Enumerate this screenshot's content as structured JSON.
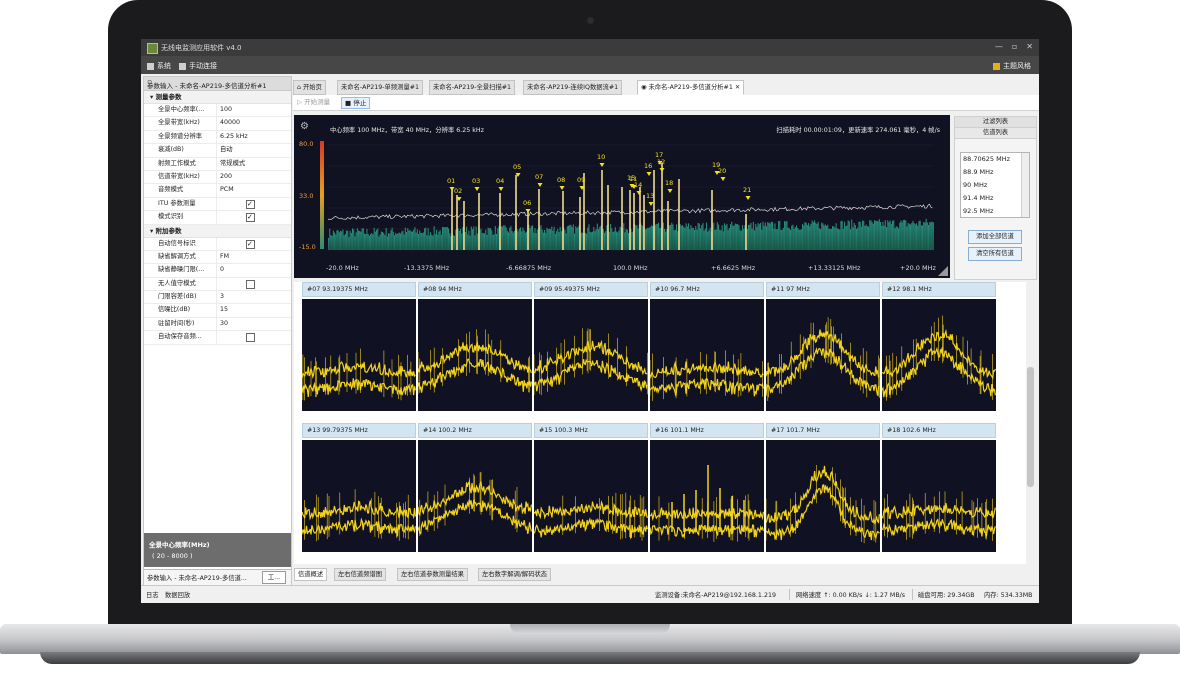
{
  "window": {
    "title": "无线电监测应用软件 v4.0",
    "controls": [
      "—",
      "▫",
      "✕"
    ]
  },
  "menu": {
    "system": "系统",
    "manual_connect": "手动连接",
    "theme": "主题风格"
  },
  "left_panel": {
    "title": "参数输入 - 未命名-AP219-多信道分析#1",
    "groups": [
      {
        "label": "测量参数",
        "rows": [
          {
            "k": "全景中心频率(...",
            "v": "100"
          },
          {
            "k": "全景带宽(kHz)",
            "v": "40000"
          },
          {
            "k": "全景频谱分辨率",
            "v": "6.25 kHz"
          },
          {
            "k": "衰减(dB)",
            "v": "自动"
          },
          {
            "k": "射频工作模式",
            "v": "常规模式"
          },
          {
            "k": "信道带宽(kHz)",
            "v": "200"
          },
          {
            "k": "音频模式",
            "v": "PCM"
          },
          {
            "k": "ITU 参数测量",
            "v": "",
            "checked": true
          },
          {
            "k": "模式识别",
            "v": "",
            "checked": true
          }
        ]
      },
      {
        "label": "附加参数",
        "rows": [
          {
            "k": "自动信号标识",
            "v": "",
            "checked": true
          },
          {
            "k": "缺省解调方式",
            "v": "FM"
          },
          {
            "k": "缺省静噪门限(...",
            "v": "0"
          },
          {
            "k": "无人值守模式",
            "v": "",
            "checked": false
          },
          {
            "k": "门限容差(dB)",
            "v": "3"
          },
          {
            "k": "信噪比(dB)",
            "v": "15"
          },
          {
            "k": "驻留时间(秒)",
            "v": "30"
          },
          {
            "k": "自动保存音频...",
            "v": "",
            "checked": false
          }
        ]
      }
    ],
    "desc_title": "全景中心频率(MHz)",
    "desc_value": "( 20 - 8000 )",
    "bottom_tab": "参数输入 - 未命名-AP219-多信道...",
    "bottom_tab2": "工..."
  },
  "doc_tabs": [
    {
      "label": "开始页"
    },
    {
      "label": "未命名-AP219-单频测量#1"
    },
    {
      "label": "未命名-AP219-全景扫描#1"
    },
    {
      "label": "未命名-AP219-连续IQ数据流#1"
    },
    {
      "label": "未命名-AP219-多信道分析#1",
      "close": "✕"
    }
  ],
  "toolbar": {
    "start": "开始测量",
    "stop": "停止"
  },
  "spectrum": {
    "info_left": "中心频率 100 MHz，带宽 40 MHz，分辨率 6.25 kHz",
    "info_right": "扫描耗时 00.00:01:09，更新速率 274.061 毫秒，4 帧/s",
    "y_ticks": [
      "80.0",
      "33.0",
      "-15.0"
    ],
    "x_ticks": [
      "-20.0 MHz",
      "-13.3375 MHz",
      "-6.66875 MHz",
      "100.0 MHz",
      "+6.6625 MHz",
      "+13.33125 MHz",
      "+20.0 MHz"
    ],
    "markers": [
      "01",
      "02",
      "03",
      "04",
      "05",
      "06",
      "07",
      "08",
      "09",
      "10",
      "11",
      "12",
      "13",
      "14",
      "15",
      "16",
      "17",
      "18",
      "19",
      "20",
      "21"
    ]
  },
  "side": {
    "filter_label": "过滤列表",
    "list_label": "信道列表",
    "items": [
      "88.70625 MHz",
      "88.9 MHz",
      "90 MHz",
      "91.4 MHz",
      "92.5 MHz"
    ],
    "add_all": "添加全部信道",
    "clear_all": "清空所有信道"
  },
  "channels": [
    {
      "label": "#07 93.19375 MHz",
      "shape": "flat"
    },
    {
      "label": "#08 94 MHz",
      "shape": "wide"
    },
    {
      "label": "#09 95.49375 MHz",
      "shape": "wide"
    },
    {
      "label": "#10 96.7 MHz",
      "shape": "flat"
    },
    {
      "label": "#11 97 MHz",
      "shape": "hump"
    },
    {
      "label": "#12 98.1 MHz",
      "shape": "hump"
    },
    {
      "label": "#13 99.79375 MHz",
      "shape": "flat"
    },
    {
      "label": "#14 100.2 MHz",
      "shape": "wide"
    },
    {
      "label": "#15 100.3 MHz",
      "shape": "flat"
    },
    {
      "label": "#16 101.1 MHz",
      "shape": "spikes"
    },
    {
      "label": "#17 101.7 MHz",
      "shape": "peak"
    },
    {
      "label": "#18 102.6 MHz",
      "shape": "flat"
    }
  ],
  "bottom_tabs": [
    "信道概述",
    "左右信道频谱图",
    "左右信道参数测量结果",
    "左右数字解调/解码状态"
  ],
  "status": {
    "left1": "日志",
    "left2": "数据回放",
    "device": "监测设备:未命名-AP219@192.168.1.219",
    "net": "网络速度 ↑: 0.00 KB/s ↓: 1.27 MB/s",
    "disk": "磁盘可用: 29.34GB",
    "mem": "内存: 534.33MB"
  },
  "colors": {
    "trace": "#f2d31a",
    "spectrum_bg": "#101121",
    "fill_top": "#2aa58e",
    "fill_bottom": "#1d6f55"
  }
}
